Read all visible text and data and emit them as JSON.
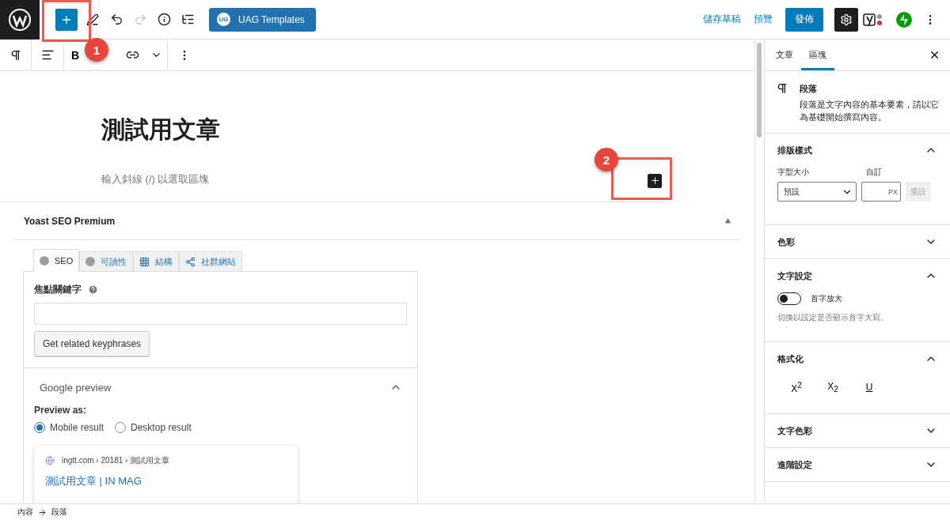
{
  "topbar": {
    "add_button": {
      "selected": true
    },
    "history": [
      {
        "kind": "undo",
        "disabled": false
      },
      {
        "kind": "redo",
        "disabled": true
      }
    ],
    "templates_button": {
      "badge": "UG",
      "label": "UAG Templates"
    },
    "save_draft": "儲存草稿",
    "preview": "預覽",
    "publish": "發佈",
    "settings": {
      "pressed": true
    }
  },
  "block_toolbar": {
    "bold_label": "B"
  },
  "editor": {
    "title": "測試用文章",
    "block_placeholder": "輸入斜線 (/) 以選取區塊"
  },
  "annotations": [
    {
      "number": "1"
    },
    {
      "number": "2"
    }
  ],
  "yoast": {
    "title": "Yoast SEO Premium",
    "expanded": true,
    "tabs": [
      {
        "kind": "dot",
        "label": "SEO",
        "selected": true
      },
      {
        "kind": "dot",
        "label": "可讀性",
        "selected": false
      },
      {
        "kind": "grid",
        "label": "結構",
        "selected": false
      },
      {
        "kind": "share",
        "label": "社群網站",
        "selected": false
      }
    ],
    "focus_keyphrase": {
      "label": "焦點關鍵字"
    },
    "related_button": "Get related keyphrases",
    "google_preview": {
      "title": "Google preview",
      "expanded": true,
      "preview_as": "Preview as:",
      "options": [
        {
          "label": "Mobile result",
          "selected": true
        },
        {
          "label": "Desktop result",
          "selected": false
        }
      ],
      "snippet": {
        "url": "ingtt.com › 20181 › 測試用文章",
        "title": "測試用文章 | IN MAG"
      }
    }
  },
  "sidebar": {
    "tabs": [
      {
        "label": "文章",
        "selected": false
      },
      {
        "label": "區塊",
        "selected": true
      }
    ],
    "block": {
      "name": "段落",
      "description": "段落是文字內容的基本要素，請以它為基礎開始撰寫內容。"
    },
    "panels": [
      {
        "kind": "typography",
        "title": "排版樣式",
        "expanded": true,
        "size_label": "字型大小",
        "custom_label": "自訂",
        "size_value": "預設",
        "unit": "PX",
        "reset": "重設",
        "reset_disabled": true
      },
      {
        "kind": "plain",
        "title": "色彩",
        "expanded": false
      },
      {
        "kind": "text",
        "title": "文字設定",
        "expanded": true,
        "toggle_label": "首字放大",
        "on": false,
        "help": "切換以設定是否顯示首字大寫。"
      },
      {
        "kind": "format",
        "title": "格式化",
        "expanded": true,
        "buttons": [
          "X$^{2}$",
          "X$_{2}$",
          "U"
        ]
      },
      {
        "kind": "plain",
        "title": "文字色彩",
        "expanded": false
      },
      {
        "kind": "plain",
        "title": "進階設定",
        "expanded": false
      }
    ]
  },
  "breadcrumbs": [
    "內容",
    "段落"
  ]
}
